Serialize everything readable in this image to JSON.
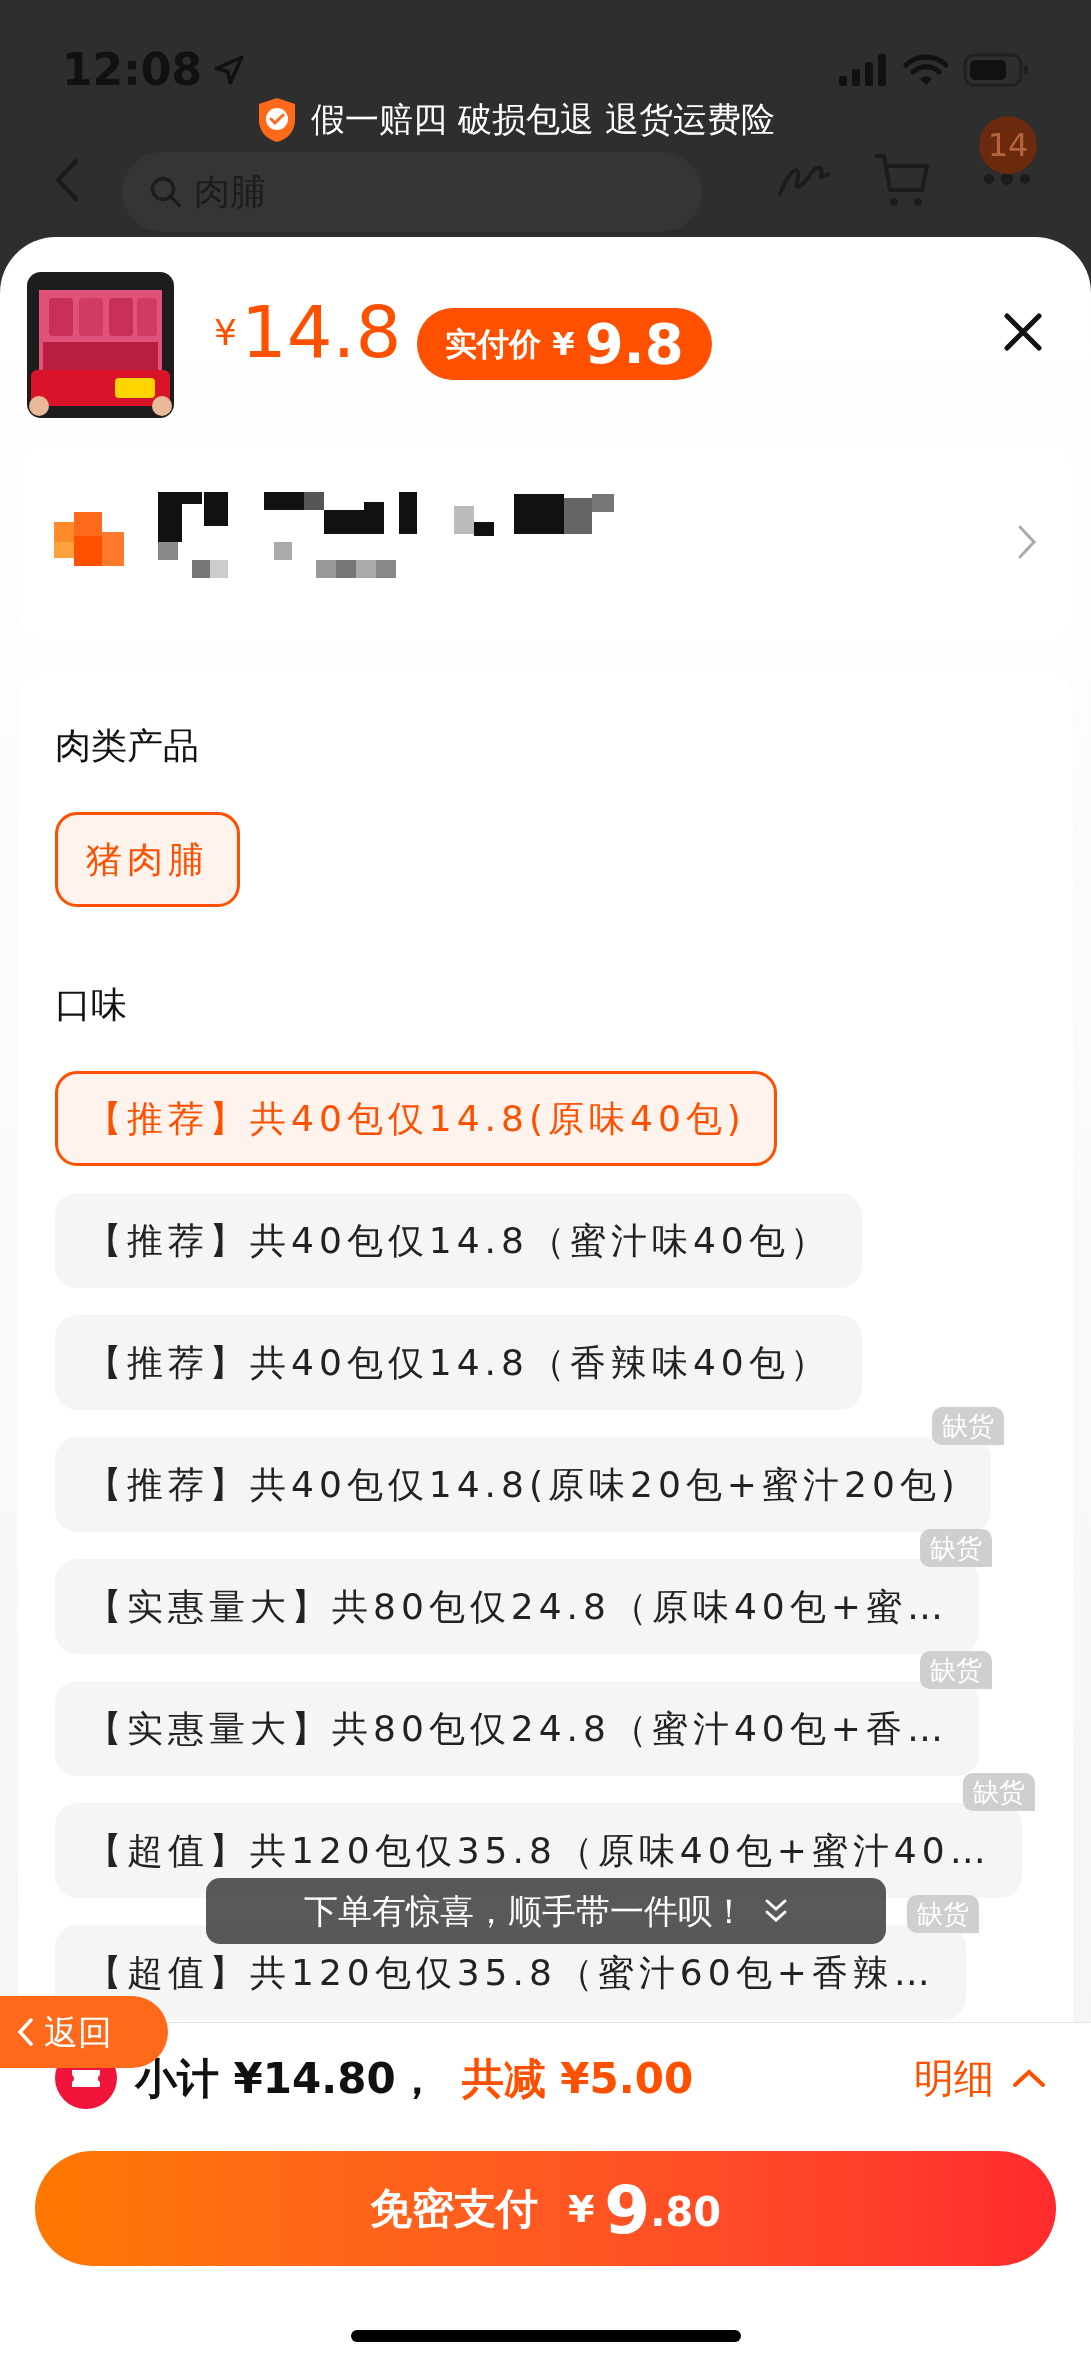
{
  "status_bar": {
    "time": "12:08"
  },
  "nav": {
    "search_text": "肉脯",
    "cart_badge": "14"
  },
  "guarantee_banner": "假一赔四 破损包退 退货运费险",
  "product": {
    "currency": "¥",
    "price": "14.8",
    "final_label": "实付价",
    "final_currency": "¥",
    "final_price": "9.8"
  },
  "groups": [
    {
      "title": "肉类产品",
      "options": [
        {
          "label": "猪肉脯",
          "selected": true
        }
      ]
    },
    {
      "title": "口味",
      "options": [
        {
          "label": "【推荐】共40包仅14.8(原味40包)",
          "selected": true
        },
        {
          "label": "【推荐】共40包仅14.8（蜜汁味40包）",
          "selected": false
        },
        {
          "label": "【推荐】共40包仅14.8（香辣味40包）",
          "selected": false
        },
        {
          "label": "【推荐】共40包仅14.8(原味20包+蜜汁20包)",
          "selected": false,
          "badge": "缺货"
        },
        {
          "label": "【实惠量大】共80包仅24.8（原味40包+蜜…",
          "selected": false,
          "badge": "缺货"
        },
        {
          "label": "【实惠量大】共80包仅24.8（蜜汁40包+香…",
          "selected": false,
          "badge": "缺货"
        },
        {
          "label": "【超值】共120包仅35.8（原味40包+蜜汁40…",
          "selected": false,
          "badge": "缺货"
        },
        {
          "label": "【超值】共120包仅35.8（蜜汁60包+香辣…",
          "selected": false,
          "badge": "缺货"
        }
      ]
    }
  ],
  "toast": "下单有惊喜，顺手带一件呗！",
  "back_button": "返回",
  "summary": {
    "subtotal": "小计 ¥14.80，",
    "discount": "共减 ¥5.00",
    "details": "明细"
  },
  "pay_button": {
    "label": "免密支付",
    "currency": "¥",
    "integer": "9",
    "decimal": ".80"
  }
}
